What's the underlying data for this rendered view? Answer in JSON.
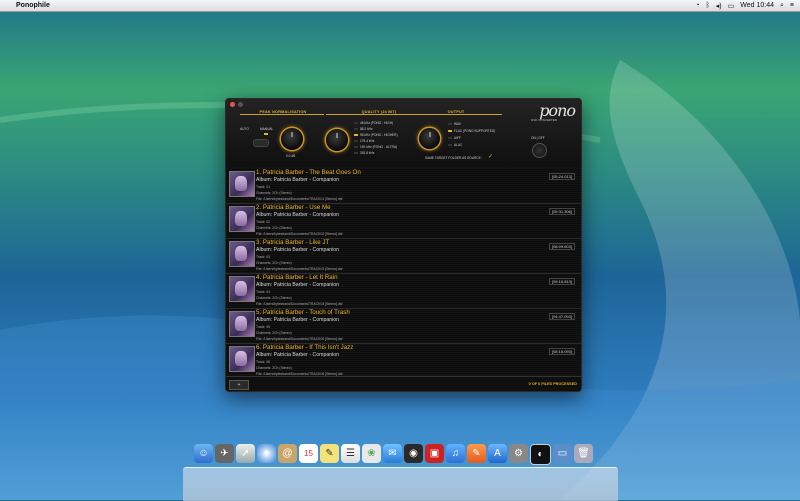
{
  "menubar": {
    "app_name": "Ponophile",
    "time": "Wed 10:44"
  },
  "app": {
    "logo": "pono",
    "logo_sub": "DSD CONVERTER",
    "sections": {
      "peak_title": "PEAK NORMALISATION",
      "quality_title": "QUALITY (24 BIT)",
      "output_title": "OUTPUT",
      "auto_label": "AUTO",
      "manual_label": "MANUAL",
      "db_label": "0.0 dB",
      "onoff_label": "ON | OFF",
      "same_folder_label": "SAME TARGET FOLDER AS SOURCE:"
    },
    "quality_options": [
      "48 kHz (PONO - HIGH)",
      "88.2 kHz",
      "96 kHz (PONO - HIGHER)",
      "176.4 kHz",
      "192 kHz (PONO - ULTRA)",
      "352.8 kHz"
    ],
    "quality_selected_index": 2,
    "output_options": [
      "WAV",
      "FLAC (PONO SUPPORTED)",
      "AIFF",
      "ALAC"
    ],
    "output_selected_index": 1,
    "tracks": [
      {
        "title": "1. Patricia Barber - The Beat Goes On",
        "album": "Album: Patricia Barber - Companion",
        "track": "Track: 01",
        "channels": "Channels: 2Ch (Stereo)",
        "file": "File: /Users/bytestrand/Documents/TRACK01 [Stereo].dsf",
        "duration": "[05:24.013]"
      },
      {
        "title": "2. Patricia Barber - Use Me",
        "album": "Album: Patricia Barber - Companion",
        "track": "Track: 02",
        "channels": "Channels: 2Ch (Stereo)",
        "file": "File: /Users/bytestrand/Documents/TRACK02 [Stereo].dsf",
        "duration": "[05:31.306]"
      },
      {
        "title": "3. Patricia Barber - Like JT",
        "album": "Album: Patricia Barber - Companion",
        "track": "Track: 03",
        "channels": "Channels: 2Ch (Stereo)",
        "file": "File: /Users/bytestrand/Documents/TRACK03 [Stereo].dsf",
        "duration": "[08:09.603]"
      },
      {
        "title": "4. Patricia Barber - Let It Rain",
        "album": "Album: Patricia Barber - Companion",
        "track": "Track: 04",
        "channels": "Channels: 2Ch (Stereo)",
        "file": "File: /Users/bytestrand/Documents/TRACK04 [Stereo].dsf",
        "duration": "[05:16.813]"
      },
      {
        "title": "5. Patricia Barber - Touch of Trash",
        "album": "Album: Patricia Barber - Companion",
        "track": "Track: 05",
        "channels": "Channels: 2Ch (Stereo)",
        "file": "File: /Users/bytestrand/Documents/TRACK05 [Stereo].dsf",
        "duration": "[04:47.093]"
      },
      {
        "title": "6. Patricia Barber - If This Isn't Jazz",
        "album": "Album: Patricia Barber - Companion",
        "track": "Track: 06",
        "channels": "Channels: 2Ch (Stereo)",
        "file": "File: /Users/bytestrand/Documents/TRACK06 [Stereo].dsf",
        "duration": "[05:15.093]"
      }
    ],
    "status": "0 OF 6 FILES PROCESSED",
    "add_button": "+"
  },
  "dock": {
    "calendar_day": "15"
  },
  "colors": {
    "accent": "#e6b325",
    "window_bg": "#121212"
  }
}
